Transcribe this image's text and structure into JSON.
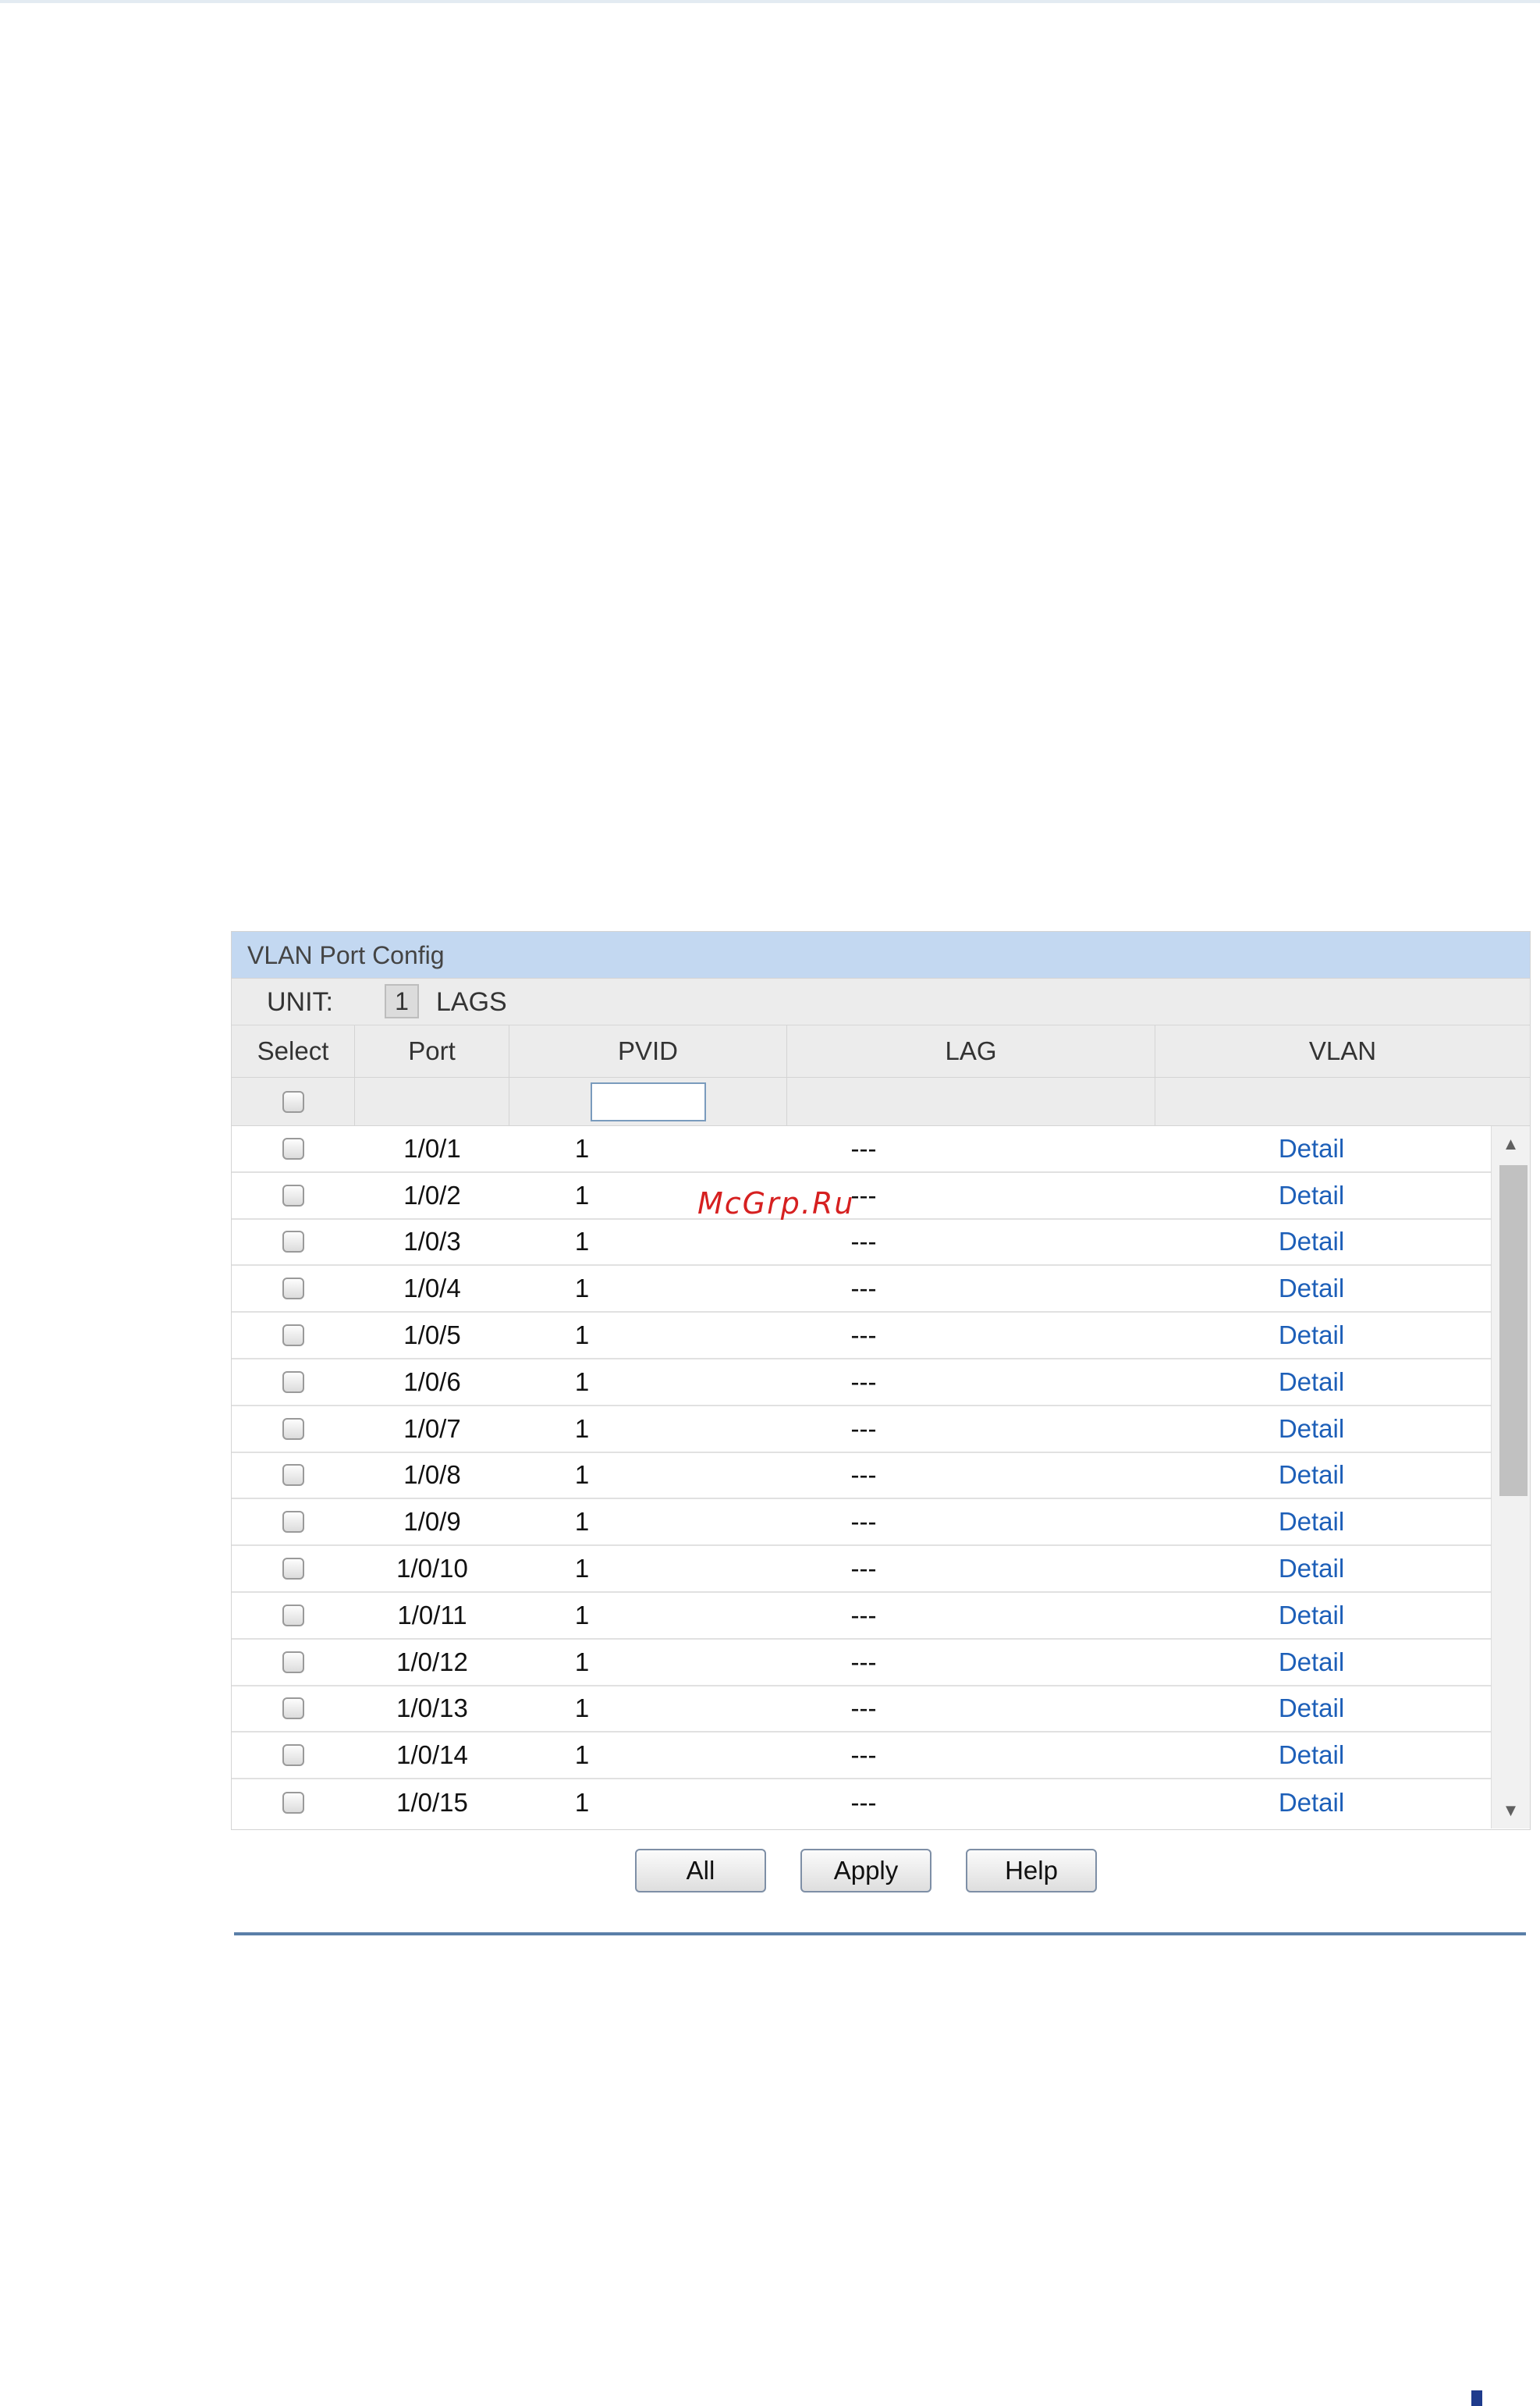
{
  "panel": {
    "title": "VLAN Port Config"
  },
  "unit": {
    "label": "UNIT:",
    "selected": "1",
    "lags": "LAGS"
  },
  "table": {
    "headers": [
      "Select",
      "Port",
      "PVID",
      "LAG",
      "VLAN"
    ],
    "rows": [
      {
        "port": "1/0/1",
        "pvid": "1",
        "lag": "---",
        "vlan": "Detail"
      },
      {
        "port": "1/0/2",
        "pvid": "1",
        "lag": "---",
        "vlan": "Detail"
      },
      {
        "port": "1/0/3",
        "pvid": "1",
        "lag": "---",
        "vlan": "Detail"
      },
      {
        "port": "1/0/4",
        "pvid": "1",
        "lag": "---",
        "vlan": "Detail"
      },
      {
        "port": "1/0/5",
        "pvid": "1",
        "lag": "---",
        "vlan": "Detail"
      },
      {
        "port": "1/0/6",
        "pvid": "1",
        "lag": "---",
        "vlan": "Detail"
      },
      {
        "port": "1/0/7",
        "pvid": "1",
        "lag": "---",
        "vlan": "Detail"
      },
      {
        "port": "1/0/8",
        "pvid": "1",
        "lag": "---",
        "vlan": "Detail"
      },
      {
        "port": "1/0/9",
        "pvid": "1",
        "lag": "---",
        "vlan": "Detail"
      },
      {
        "port": "1/0/10",
        "pvid": "1",
        "lag": "---",
        "vlan": "Detail"
      },
      {
        "port": "1/0/11",
        "pvid": "1",
        "lag": "---",
        "vlan": "Detail"
      },
      {
        "port": "1/0/12",
        "pvid": "1",
        "lag": "---",
        "vlan": "Detail"
      },
      {
        "port": "1/0/13",
        "pvid": "1",
        "lag": "---",
        "vlan": "Detail"
      },
      {
        "port": "1/0/14",
        "pvid": "1",
        "lag": "---",
        "vlan": "Detail"
      },
      {
        "port": "1/0/15",
        "pvid": "1",
        "lag": "---",
        "vlan": "Detail"
      }
    ]
  },
  "buttons": {
    "all": "All",
    "apply": "Apply",
    "help": "Help"
  },
  "watermark": "McGrp.Ru",
  "icons": {
    "scroll_up": "scroll-up-arrow-icon",
    "scroll_down": "scroll-down-arrow-icon"
  }
}
